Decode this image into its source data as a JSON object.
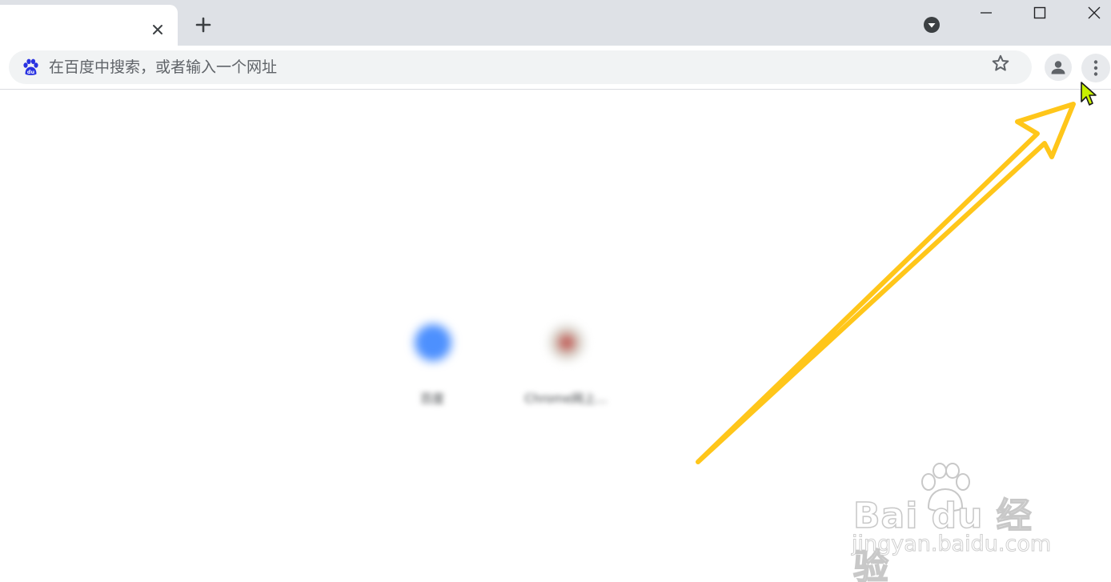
{
  "tabstrip": {
    "tab_close_icon": "close-icon",
    "new_tab_icon": "plus-icon",
    "tab_search_icon": "dropdown-circle-icon"
  },
  "window_controls": {
    "minimize_icon": "minimize-icon",
    "maximize_icon": "maximize-icon",
    "close_icon": "close-icon"
  },
  "toolbar": {
    "omnibox": {
      "placeholder": "在百度中搜索，或者输入一个网址",
      "value": "",
      "search_engine_icon": "baidu-paw-icon"
    },
    "bookmark_icon": "star-icon",
    "profile_icon": "person-icon",
    "menu_icon": "three-dots-vertical-icon"
  },
  "shortcuts": [
    {
      "label": "百度",
      "icon": "blurred-blue-tile"
    },
    {
      "label": "Chrome网上...",
      "icon": "blurred-store-tile"
    }
  ],
  "annotation": {
    "arrow_color": "#ffc61a",
    "cursor_color": "#c8f000"
  },
  "watermark": {
    "brand": "Bai du 经验",
    "url": "jingyan.baidu.com"
  },
  "colors": {
    "tabstrip_bg": "#dee1e6",
    "omnibox_bg": "#f1f3f4",
    "icon_gray": "#5f6368",
    "baidu_blue": "#2932e1"
  }
}
